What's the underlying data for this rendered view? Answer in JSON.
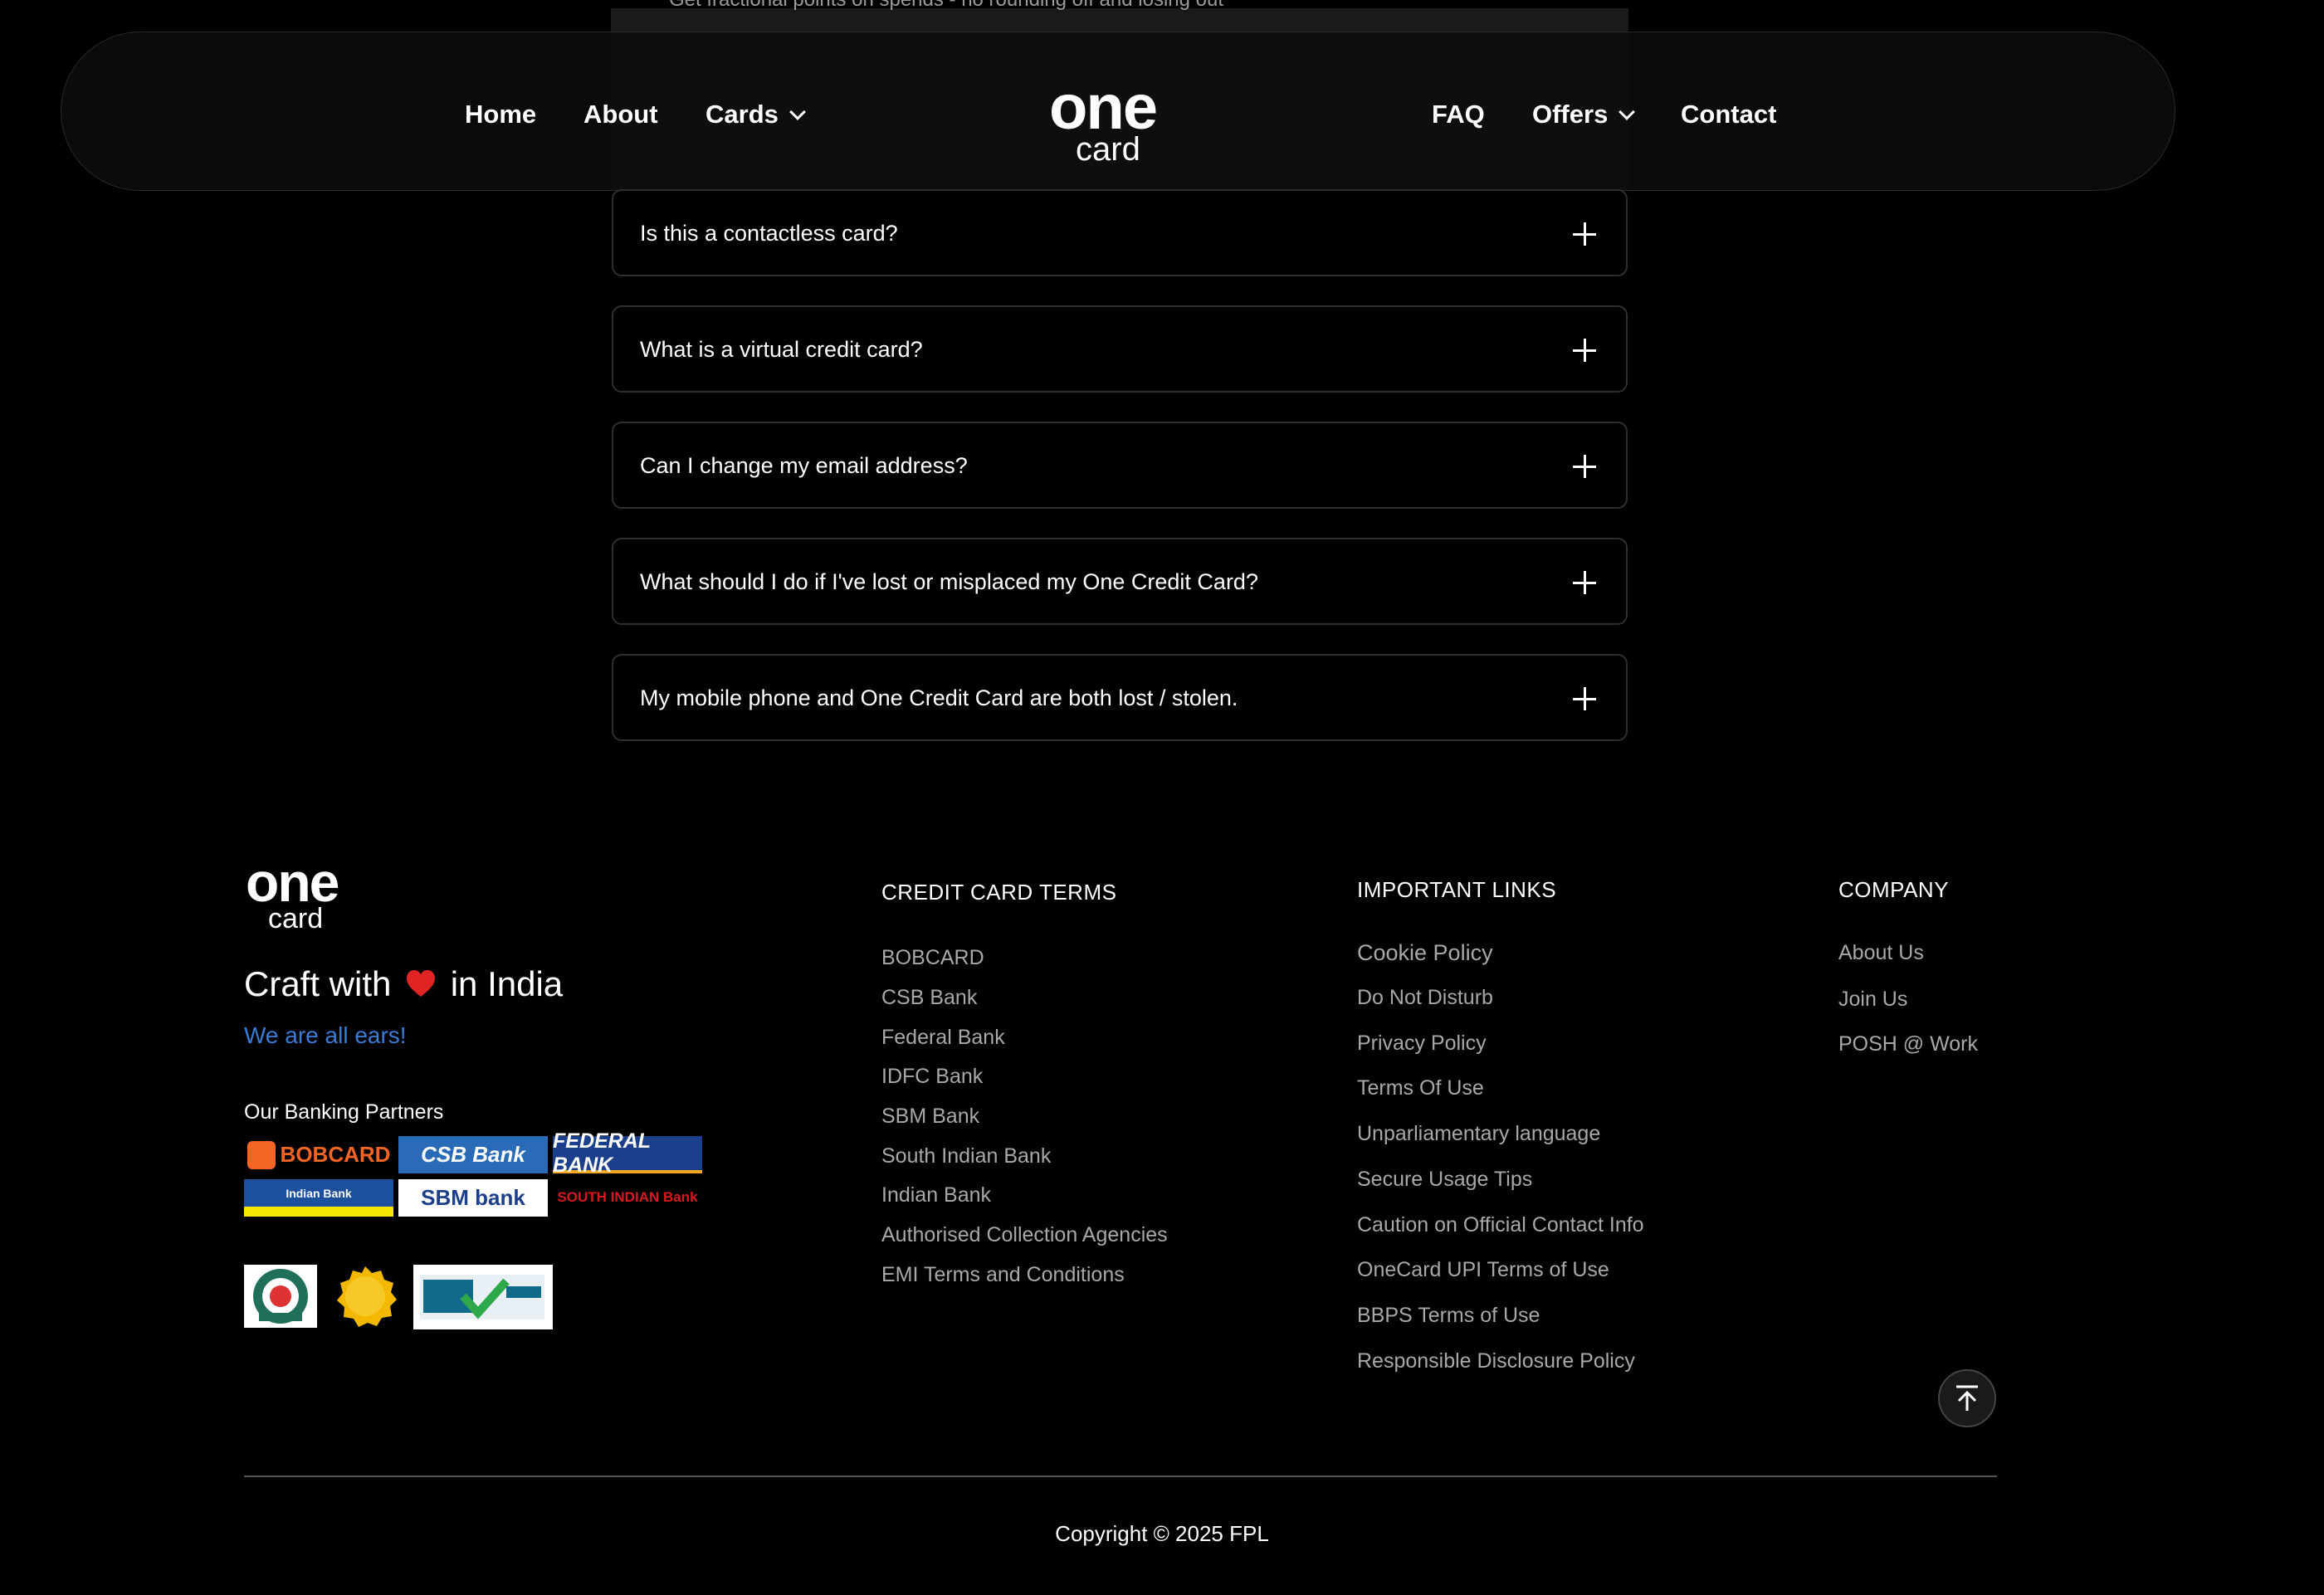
{
  "header": {
    "nav_left": [
      "Home",
      "About",
      "Cards"
    ],
    "nav_right": [
      "FAQ",
      "Offers",
      "Contact"
    ],
    "logo_main": "one",
    "logo_sub": "card"
  },
  "faq_cutoff_text": "Get fractional points on spends - no rounding off and losing out",
  "faqs": [
    "Is this a contactless card?",
    "What is a virtual credit card?",
    "Can I change my email address?",
    "What should I do if I've lost or misplaced my One Credit Card?",
    "My mobile phone and One Credit Card are both lost / stolen."
  ],
  "footer": {
    "logo_main": "one",
    "logo_sub": "card",
    "tagline_before": "Craft with",
    "tagline_after": "in India",
    "ears": "We are all ears!",
    "partners_label": "Our Banking Partners",
    "bank_logos": [
      "BOBCARD",
      "CSB Bank",
      "FEDERAL BANK",
      "Indian Bank",
      "SBM bank",
      "SOUTH INDIAN Bank"
    ],
    "credit_card_terms": {
      "title": "CREDIT CARD TERMS",
      "links": [
        "BOBCARD",
        "CSB Bank",
        "Federal Bank",
        "IDFC Bank",
        "SBM Bank",
        "South Indian Bank",
        "Indian Bank",
        "Authorised Collection Agencies",
        "EMI Terms and Conditions"
      ]
    },
    "important_links": {
      "title": "IMPORTANT LINKS",
      "links": [
        "Cookie Policy",
        "Do Not Disturb",
        "Privacy Policy",
        "Terms Of Use",
        "Unparliamentary language",
        "Secure Usage Tips",
        "Caution on Official Contact Info",
        "OneCard UPI Terms of Use",
        "BBPS Terms of Use",
        "Responsible Disclosure Policy"
      ]
    },
    "company": {
      "title": "COMPANY",
      "links": [
        "About Us",
        "Join Us",
        "POSH @ Work"
      ]
    },
    "copyright": "Copyright © 2025 FPL",
    "colors": {
      "accent_blue": "#3a7bd5",
      "heart_red": "#e02424",
      "link_gray": "#a8a8a8"
    }
  }
}
